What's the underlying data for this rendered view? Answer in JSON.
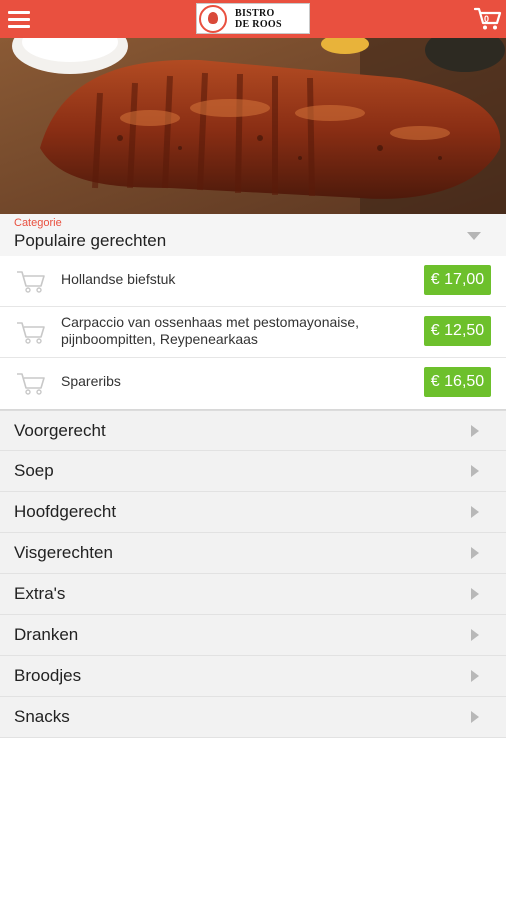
{
  "header": {
    "brand_line1": "BISTRO",
    "brand_line2": "DE ROOS",
    "cart_count": "0",
    "color": "#e9503f"
  },
  "icons": {
    "menu": "hamburger-icon",
    "cart": "shopping-cart-icon",
    "dropdown": "triangle-down-icon",
    "row_arrow": "triangle-right-icon"
  },
  "category": {
    "caption": "Categorie",
    "selected": "Populaire gerechten"
  },
  "products": [
    {
      "name": "Hollandse biefstuk",
      "price": "€ 17,00"
    },
    {
      "name": "Carpaccio van ossenhaas met pestomayonaise, pijnboompitten, Reypenearkaas",
      "price": "€ 12,50"
    },
    {
      "name": "Spareribs",
      "price": "€ 16,50"
    }
  ],
  "categories": [
    {
      "label": "Voorgerecht"
    },
    {
      "label": "Soep"
    },
    {
      "label": "Hoofdgerecht"
    },
    {
      "label": "Visgerechten"
    },
    {
      "label": "Extra's"
    },
    {
      "label": "Dranken"
    },
    {
      "label": "Broodjes"
    },
    {
      "label": "Snacks"
    }
  ],
  "colors": {
    "price_badge": "#6dc02c",
    "accent": "#e9503f"
  }
}
